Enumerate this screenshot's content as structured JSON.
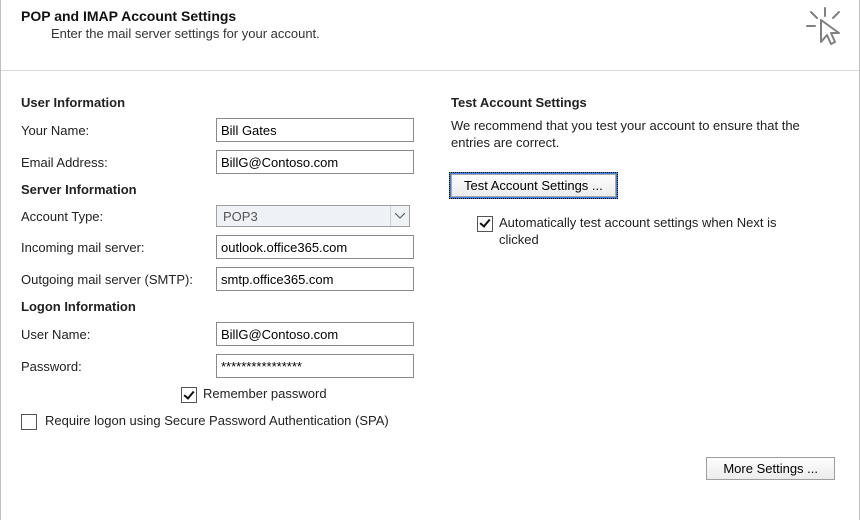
{
  "header": {
    "title": "POP and IMAP Account Settings",
    "subtitle": "Enter the mail server settings for your account."
  },
  "user_info": {
    "heading": "User Information",
    "your_name_label": "Your Name:",
    "your_name_value": "Bill Gates",
    "email_label": "Email Address:",
    "email_value": "BillG@Contoso.com"
  },
  "server_info": {
    "heading": "Server Information",
    "account_type_label": "Account Type:",
    "account_type_value": "POP3",
    "incoming_label": "Incoming mail server:",
    "incoming_value": "outlook.office365.com",
    "outgoing_label": "Outgoing mail server (SMTP):",
    "outgoing_value": "smtp.office365.com"
  },
  "logon_info": {
    "heading": "Logon Information",
    "username_label": "User Name:",
    "username_value": "BillG@Contoso.com",
    "password_label": "Password:",
    "password_value": "****************",
    "remember_label": "Remember password",
    "remember_checked": true,
    "spa_label": "Require logon using Secure Password Authentication (SPA)",
    "spa_checked": false
  },
  "test": {
    "heading": "Test Account Settings",
    "description": "We recommend that you test your account to ensure that the entries are correct.",
    "button_label": "Test Account Settings ...",
    "auto_test_label": "Automatically test account settings when Next is clicked",
    "auto_test_checked": true
  },
  "more_settings_label": "More Settings ..."
}
